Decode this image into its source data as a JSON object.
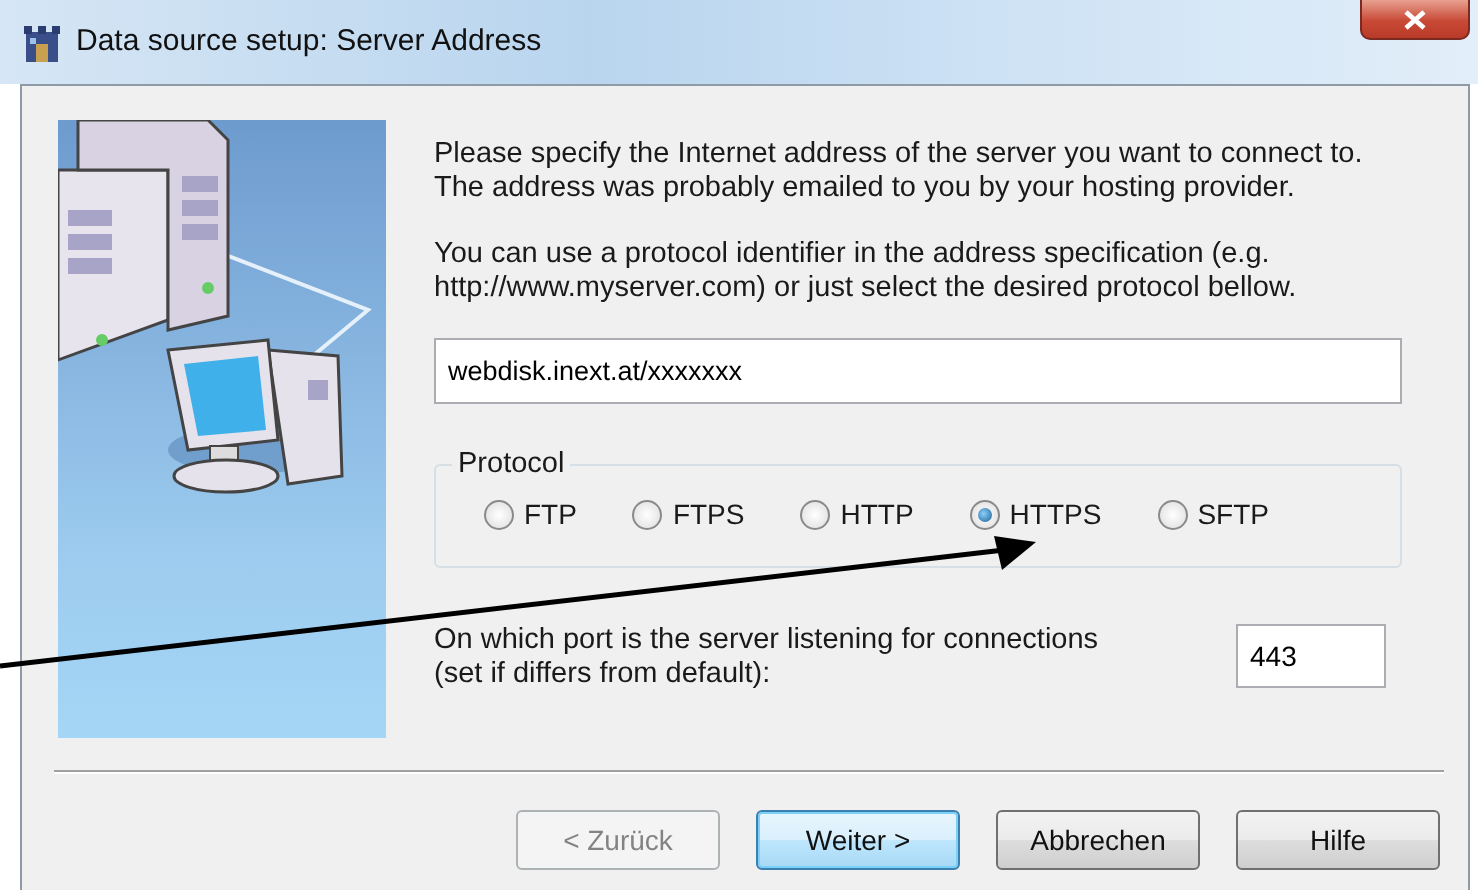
{
  "window": {
    "title": "Data source setup: Server Address"
  },
  "intro": [
    {
      "lines": [
        "Please specify the Internet address of the server you want to connect to.",
        "The address was probably emailed to you by your hosting provider."
      ]
    },
    {
      "lines": [
        "You can use a protocol identifier in the address specification (e.g.",
        "http://www.myserver.com) or just select the desired protocol bellow."
      ]
    }
  ],
  "address": {
    "value": "webdisk.inext.at/xxxxxxx"
  },
  "protocol": {
    "label": "Protocol",
    "options": [
      {
        "label": "FTP",
        "selected": false
      },
      {
        "label": "FTPS",
        "selected": false
      },
      {
        "label": "HTTP",
        "selected": false
      },
      {
        "label": "HTTPS",
        "selected": true
      },
      {
        "label": "SFTP",
        "selected": false
      }
    ]
  },
  "port": {
    "label_lines": [
      "On which port is the server listening for connections",
      "(set if differs from default):"
    ],
    "value": "443"
  },
  "buttons": [
    {
      "label": "< Zurück",
      "disabled": true,
      "default": false
    },
    {
      "label": "Weiter >",
      "disabled": false,
      "default": true
    },
    {
      "label": "Abbrechen",
      "disabled": false,
      "default": false
    },
    {
      "label": "Hilfe",
      "disabled": false,
      "default": false
    }
  ]
}
